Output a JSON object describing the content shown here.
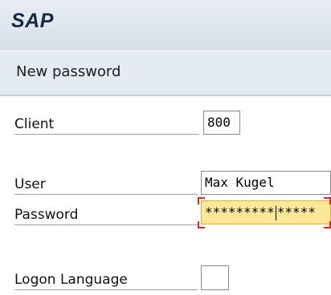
{
  "header": {
    "logo": "SAP"
  },
  "title_bar": {
    "title": "New password"
  },
  "form": {
    "client": {
      "label": "Client",
      "value": "800"
    },
    "user": {
      "label": "User",
      "value": "Max Kugel"
    },
    "password": {
      "label": "Password",
      "value_before_caret": "*********",
      "value_after_caret": "*****",
      "focused": true
    },
    "logon_language": {
      "label": "Logon Language",
      "value": ""
    }
  },
  "colors": {
    "header_bg": "#dbe3ec",
    "title_bar_bg": "#e4ebf2",
    "focused_field_bg": "#fde89a",
    "focus_marker": "#d8281e"
  }
}
